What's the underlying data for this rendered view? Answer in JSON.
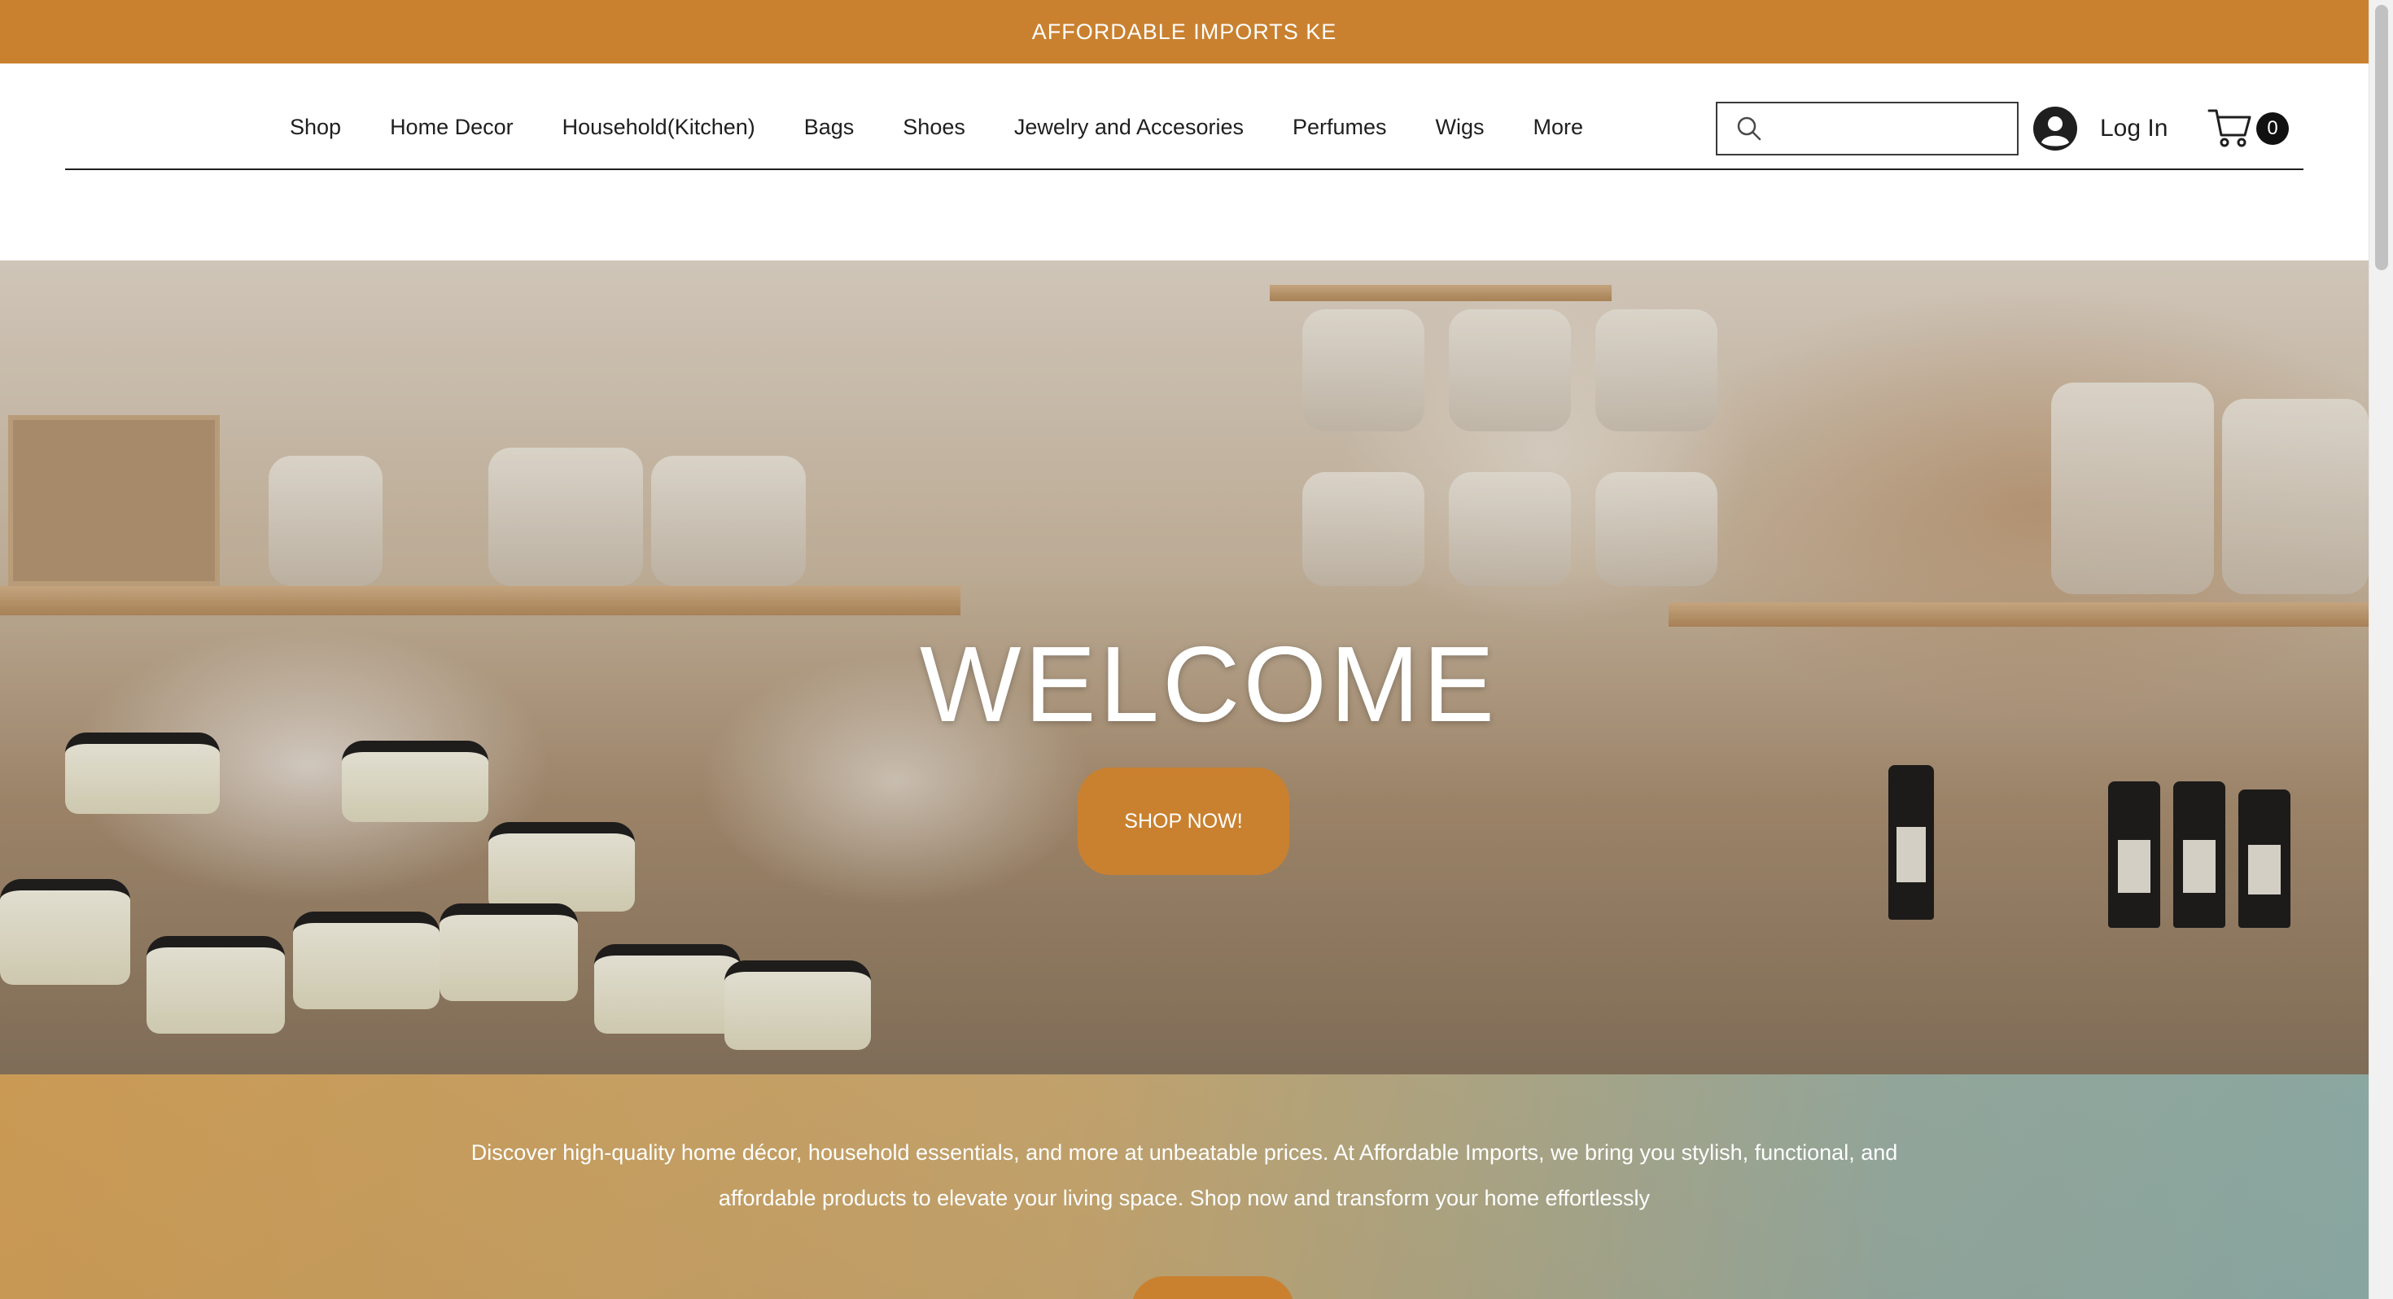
{
  "announcement": {
    "text": "AFFORDABLE IMPORTS KE"
  },
  "nav": {
    "items": [
      {
        "label": "Shop"
      },
      {
        "label": "Home Decor"
      },
      {
        "label": "Household(Kitchen)"
      },
      {
        "label": "Bags"
      },
      {
        "label": "Shoes"
      },
      {
        "label": "Jewelry and Accesories"
      },
      {
        "label": "Perfumes"
      },
      {
        "label": "Wigs"
      },
      {
        "label": "More"
      }
    ]
  },
  "search": {
    "value": "",
    "placeholder": ""
  },
  "account": {
    "login_label": "Log In"
  },
  "cart": {
    "count": "0"
  },
  "hero": {
    "title": "WELCOME",
    "cta_label": "SHOP NOW!"
  },
  "intro": {
    "text": "Discover high-quality home décor, household essentials, and more at unbeatable prices. At Affordable Imports, we bring you stylish, functional, and affordable products to elevate your living space. Shop now and transform your home effortlessly"
  },
  "colors": {
    "accent": "#c98130",
    "text": "#1f1f1f",
    "badge": "#111111"
  },
  "icons": [
    "search-icon",
    "user-avatar-icon",
    "shopping-cart-icon"
  ]
}
